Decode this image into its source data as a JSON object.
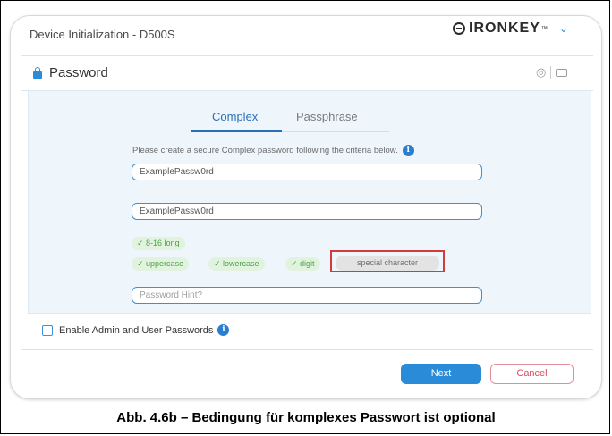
{
  "window": {
    "title": "Device Initialization - D500S"
  },
  "brand": {
    "logo_text": "IRONKEY",
    "trademark": "™",
    "menu_icon": "chevron-down-icon"
  },
  "section": {
    "title": "Password",
    "icon": "lock-icon",
    "tools": [
      "eye-icon",
      "keyboard-icon"
    ]
  },
  "tabs": [
    {
      "label": "Complex",
      "active": true
    },
    {
      "label": "Passphrase",
      "active": false
    }
  ],
  "instruction": {
    "text": "Please create a secure Complex password following the criteria below.",
    "icon": "info-icon"
  },
  "fields": {
    "password": "ExamplePassw0rd",
    "confirm": "ExamplePassw0rd",
    "hint_placeholder": "Password Hint?"
  },
  "criteria": [
    {
      "label": "✓ 8-16 long",
      "met": true
    },
    {
      "label": "✓ uppercase",
      "met": true
    },
    {
      "label": "✓ lowercase",
      "met": true
    },
    {
      "label": "✓ digit",
      "met": true
    },
    {
      "label": "special character",
      "met": false
    }
  ],
  "options": {
    "admin_user_label": "Enable Admin and User Passwords",
    "checked": false,
    "icon": "info-icon"
  },
  "buttons": {
    "next": "Next",
    "cancel": "Cancel"
  },
  "caption": "Abb. 4.6b – Bedingung für komplexes Passwort ist optional",
  "colors": {
    "accent": "#2a8bd8",
    "criteria_met": "#4da24a",
    "highlight": "#d23b3b",
    "cancel": "#d94b62"
  }
}
